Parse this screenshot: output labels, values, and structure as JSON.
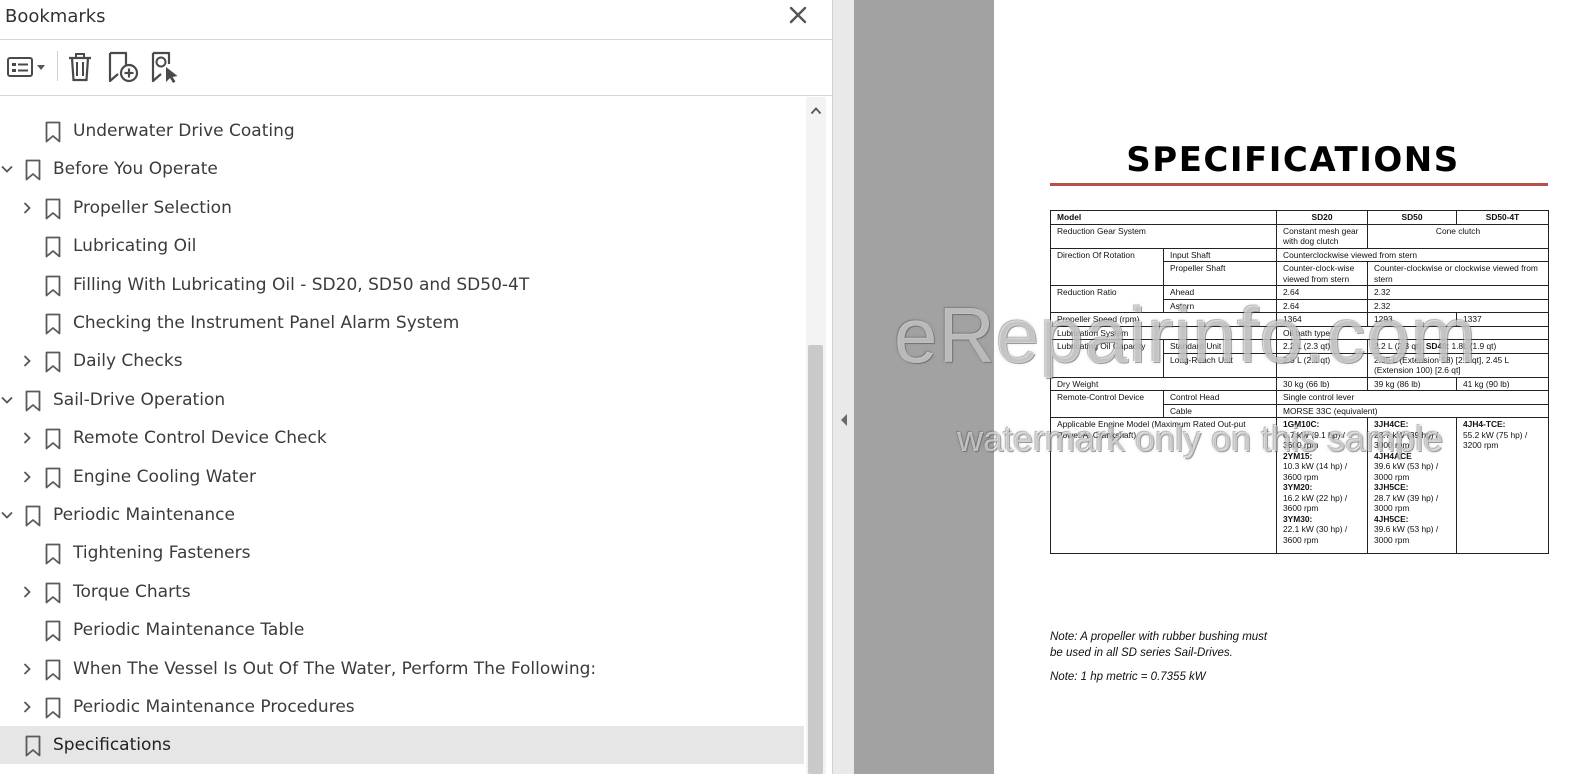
{
  "panel": {
    "title": "Bookmarks",
    "close_icon": "close-icon",
    "toolbar": {
      "options_icon": "bookmark-options-icon",
      "delete_icon": "trash-icon",
      "new_bookmark_icon": "new-bookmark-icon",
      "find_bookmark_icon": "find-current-bookmark-icon"
    }
  },
  "tree": {
    "items": [
      {
        "label": "Underwater Drive Coating",
        "level": 1,
        "expandable": false,
        "expanded": false,
        "selected": false
      },
      {
        "label": "Before You Operate",
        "level": 0,
        "expandable": true,
        "expanded": true,
        "selected": false
      },
      {
        "label": "Propeller Selection",
        "level": 1,
        "expandable": true,
        "expanded": false,
        "selected": false
      },
      {
        "label": "Lubricating Oil",
        "level": 1,
        "expandable": false,
        "expanded": false,
        "selected": false
      },
      {
        "label": "Filling With Lubricating Oil - SD20, SD50 and SD50-4T",
        "level": 1,
        "expandable": false,
        "expanded": false,
        "selected": false
      },
      {
        "label": "Checking the Instrument Panel Alarm System",
        "level": 1,
        "expandable": false,
        "expanded": false,
        "selected": false
      },
      {
        "label": "Daily Checks",
        "level": 1,
        "expandable": true,
        "expanded": false,
        "selected": false
      },
      {
        "label": "Sail-Drive Operation",
        "level": 0,
        "expandable": true,
        "expanded": true,
        "selected": false
      },
      {
        "label": "Remote Control Device Check",
        "level": 1,
        "expandable": true,
        "expanded": false,
        "selected": false
      },
      {
        "label": "Engine Cooling Water",
        "level": 1,
        "expandable": true,
        "expanded": false,
        "selected": false
      },
      {
        "label": " Periodic Maintenance",
        "level": 0,
        "expandable": true,
        "expanded": true,
        "selected": false
      },
      {
        "label": "Tightening Fasteners",
        "level": 1,
        "expandable": false,
        "expanded": false,
        "selected": false
      },
      {
        "label": "Torque Charts",
        "level": 1,
        "expandable": true,
        "expanded": false,
        "selected": false
      },
      {
        "label": "Periodic Maintenance Table",
        "level": 1,
        "expandable": false,
        "expanded": false,
        "selected": false
      },
      {
        "label": "When The Vessel Is Out Of The Water, Perform The Following:",
        "level": 1,
        "expandable": true,
        "expanded": false,
        "selected": false
      },
      {
        "label": "Periodic Maintenance Procedures",
        "level": 1,
        "expandable": true,
        "expanded": false,
        "selected": false
      },
      {
        "label": "Specifications",
        "level": 0,
        "expandable": false,
        "expanded": false,
        "selected": true
      }
    ]
  },
  "document": {
    "title": "SPECIFICATIONS",
    "accent_color": "#b5504a",
    "table": {
      "header": {
        "model": "Model",
        "sd20": "SD20",
        "sd50": "SD50",
        "sd504t": "SD50-4T"
      },
      "reduction_gear": {
        "label": "Reduction Gear System",
        "sd20": "Constant mesh gear with dog clutch",
        "sd50": "Cone clutch"
      },
      "rotation": {
        "label": "Direction Of Rotation",
        "input_label": "Input Shaft",
        "input_value": "Counterclockwise viewed from stern",
        "prop_label": "Propeller Shaft",
        "prop_sd20": "Counter-clock-wise viewed from stern",
        "prop_sd50": "Counter-clockwise or clockwise viewed from stern"
      },
      "reduction_ratio": {
        "label": "Reduction Ratio",
        "ahead_label": "Ahead",
        "ahead_sd20": "2.64",
        "ahead_sd50": "2.32",
        "astern_label": "Astern",
        "astern_sd20": "2.64",
        "astern_sd50": "2.32"
      },
      "prop_speed": {
        "label": "Propeller Speed (rpm)",
        "sd20": "1364",
        "sd50": "1293",
        "sd504t": "1337"
      },
      "lube_system": {
        "label": "Lubrication System",
        "value": "Oil bath type"
      },
      "lube_capacity": {
        "label": "Lubricating Oil Capacity",
        "std_label": "Standard Unit",
        "std_sd20": "2.2 L (2.3 qt)",
        "std_sd50_a": "2.2 L (2.3 qt), ",
        "std_sd50_b": "SD40",
        "std_sd50_c": ": 1.8L (1.9 qt)",
        "long_label": "Long-Reach Unit",
        "long_sd20": "2.5 L (2.4 qt)",
        "long_sd50": "2.35 L (Extension 58) [2.5 qt], 2.45 L (Extension 100) [2.6 qt]"
      },
      "dry_weight": {
        "label": "Dry Weight",
        "sd20": "30 kg (66 lb)",
        "sd50": "39 kg (86 lb)",
        "sd504t": "41 kg (90 lb)"
      },
      "remote": {
        "label": "Remote-Control Device",
        "head_label": "Control Head",
        "head_value": "Single control lever",
        "cable_label": "Cable",
        "cable_value": "MORSE 33C (equivalent)"
      },
      "engines": {
        "label": "Applicable Engine Model (Maximum Rated Out-put Power At Crankshaft)",
        "sd20": [
          {
            "model": "1GM10C:",
            "spec": "6.7 kW (9.1 hp) / 3600 rpm"
          },
          {
            "model": "2YM15:",
            "spec": "10.3 kW (14 hp) / 3600 rpm"
          },
          {
            "model": "3YM20:",
            "spec": "16.2 kW (22 hp) / 3600 rpm"
          },
          {
            "model": "3YM30:",
            "spec": "22.1 kW (30 hp) / 3600 rpm"
          }
        ],
        "sd50": [
          {
            "model": "3JH4CE:",
            "spec": "28.7 kW (39 hp) / 3000 rpm"
          },
          {
            "model": "4JH4ACE",
            "spec": "39.6 kW (53 hp) / 3000 rpm"
          },
          {
            "model": "3JH5CE:",
            "spec": "28.7 kW (39 hp) / 3000 rpm"
          },
          {
            "model": "4JH5CE:",
            "spec": "39.6 kW (53 hp) / 3000 rpm"
          }
        ],
        "sd504t": [
          {
            "model": "4JH4-TCE:",
            "spec": "55.2 kW (75 hp) / 3200 rpm"
          }
        ]
      }
    },
    "note1_line1": "Note: A propeller with rubber bushing must",
    "note1_line2": "be used in all SD series Sail-Drives.",
    "note2": "Note: 1 hp metric = 0.7355 kW",
    "watermark_main": "eRepairinfo.com",
    "watermark_sub": "watermark only on this sample"
  }
}
